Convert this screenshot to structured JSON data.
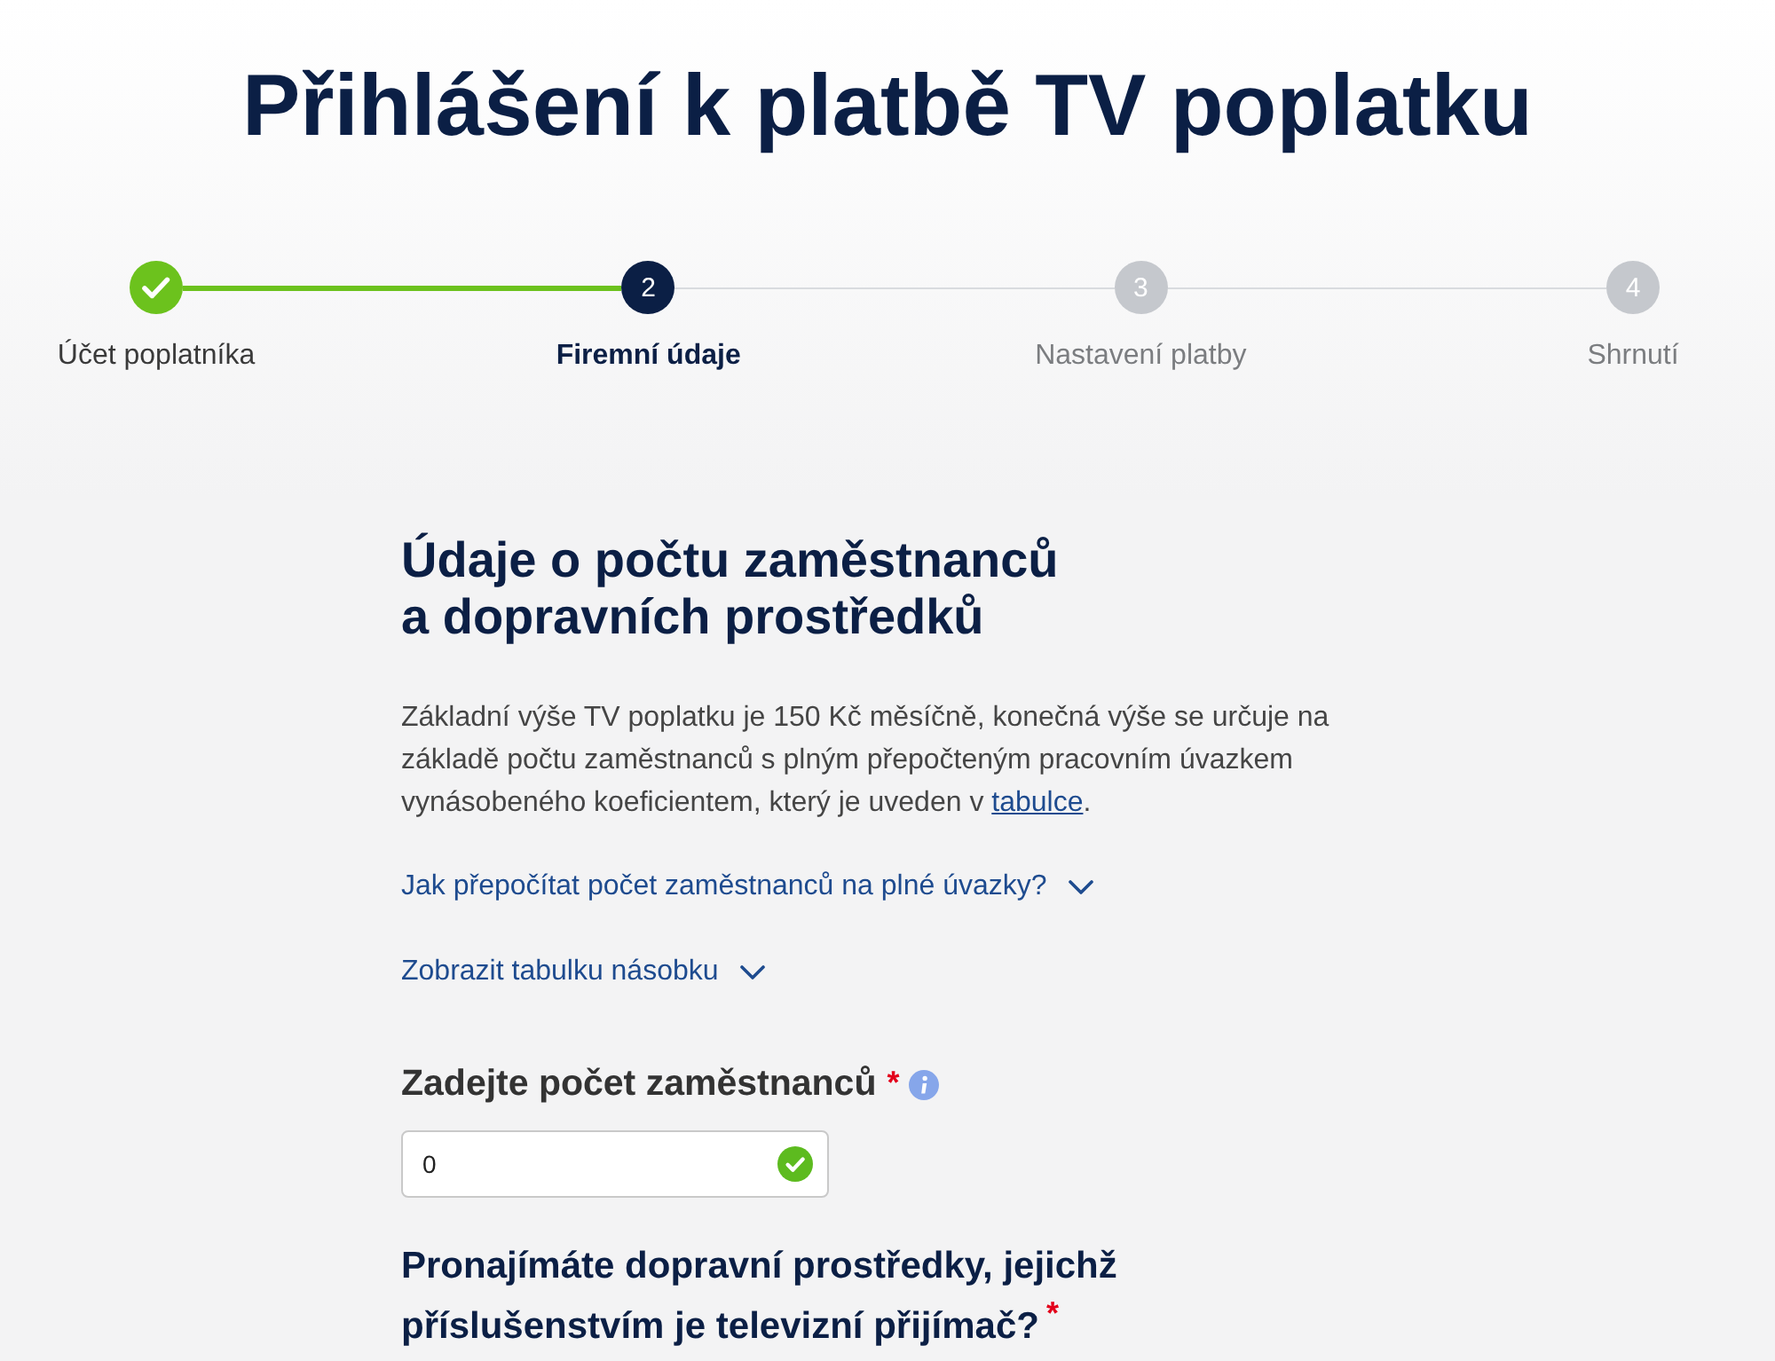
{
  "title": "Přihlášení k platbě TV poplatku",
  "steps": [
    {
      "label": "Účet poplatníka",
      "done": true,
      "selected": false
    },
    {
      "number": "2",
      "label": "Firemní údaje",
      "done": false,
      "selected": true
    },
    {
      "number": "3",
      "label": "Nastavení platby",
      "done": false,
      "selected": false
    },
    {
      "number": "4",
      "label": "Shrnutí",
      "done": false,
      "selected": false
    }
  ],
  "section": {
    "heading": "Údaje o počtu zaměstnanců\na dopravních prostředků",
    "intro": {
      "text": "Základní výše TV poplatku je 150 Kč měsíčně, konečná výše se určuje na základě počtu zaměstnanců s plným přepočteným pracovním úvazkem vynásobeného koeficientem, který je uveden v ",
      "link": "tabulce",
      "after": "."
    }
  },
  "toggles": [
    {
      "label": "Jak přepočítat počet zaměstnanců na plné úvazky?",
      "expanded": false
    },
    {
      "label": "Zobrazit tabulku násobku",
      "expanded": false
    }
  ],
  "employees_field": {
    "label": "Zadejte počet zaměstnanců",
    "required_mark": "*",
    "value": "0",
    "valid": true
  },
  "vehicles_question": {
    "label": "Pronajímáte dopravní prostředky, jejichž příslušenstvím je televizní přijímač?$^{*}$"
  }
}
